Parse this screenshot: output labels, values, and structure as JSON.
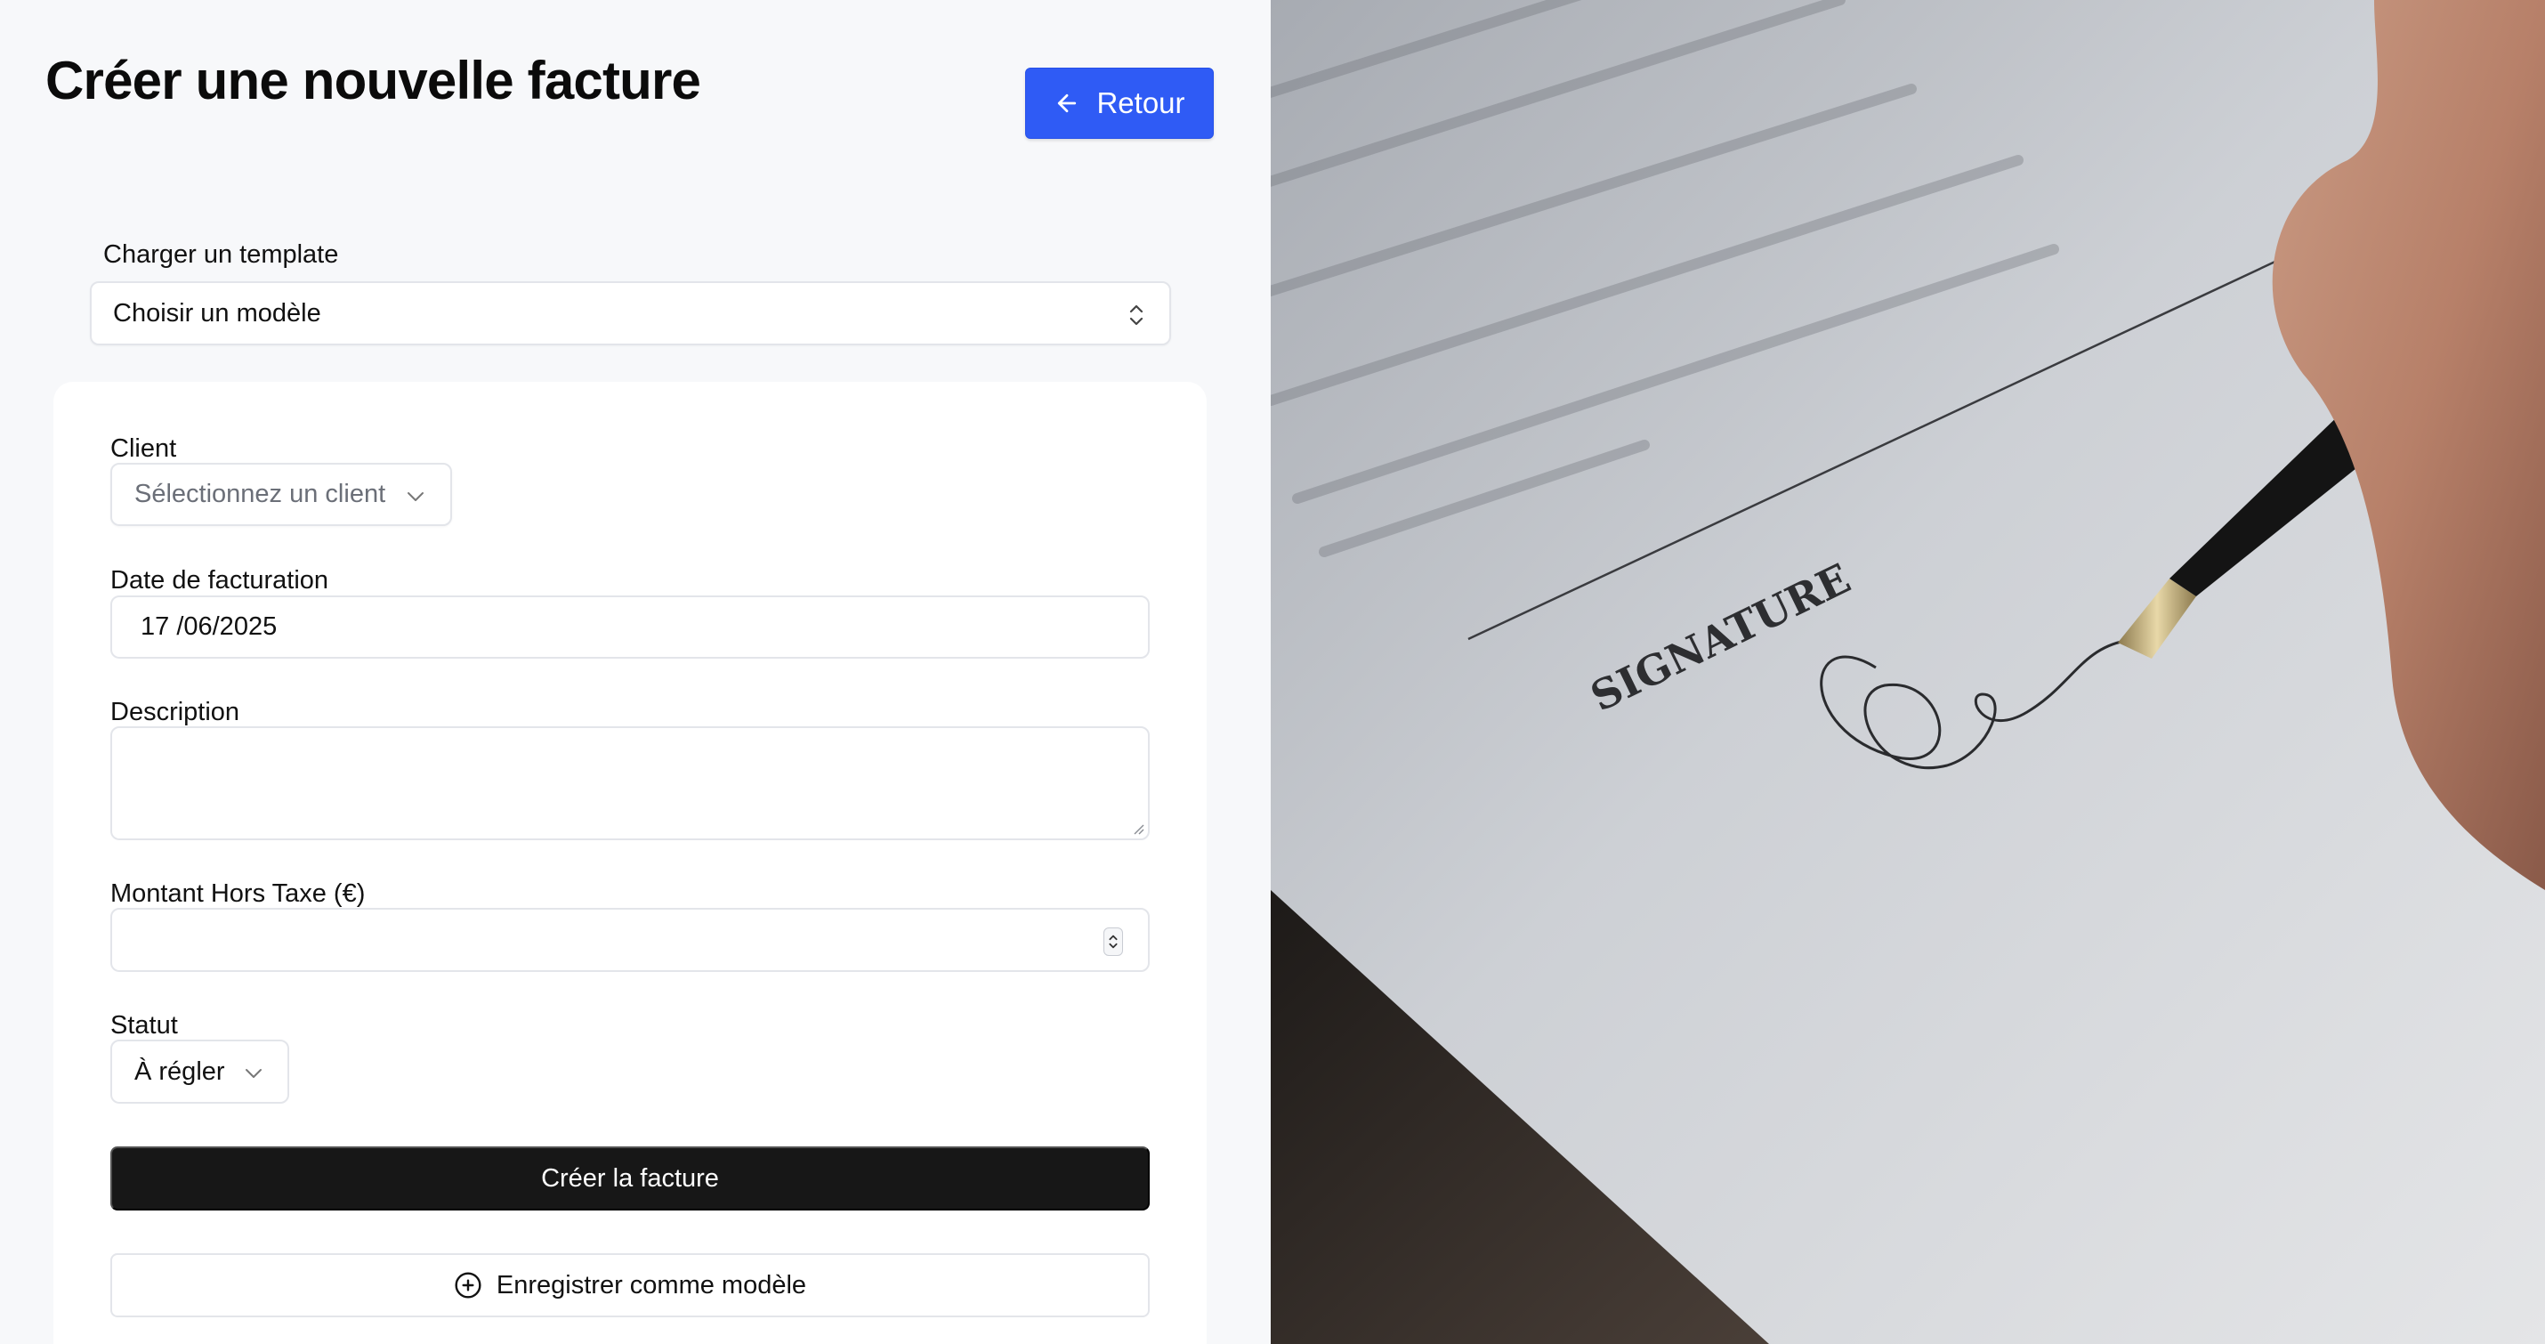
{
  "page": {
    "title": "Créer une nouvelle facture",
    "back_button": {
      "label": "Retour",
      "icon": "arrow-left-icon"
    }
  },
  "template": {
    "label": "Charger un template",
    "selected": "Choisir un modèle"
  },
  "form": {
    "client": {
      "label": "Client",
      "placeholder": "Sélectionnez un client"
    },
    "date": {
      "label": "Date de facturation",
      "value": "17 /06/2025"
    },
    "description": {
      "label": "Description",
      "value": ""
    },
    "amount": {
      "label": "Montant Hors Taxe (€)",
      "value": ""
    },
    "status": {
      "label": "Statut",
      "selected": "À régler"
    },
    "submit_label": "Créer la facture",
    "save_template": {
      "label": "Enregistrer comme modèle",
      "icon": "plus-circle-icon"
    }
  },
  "photo": {
    "signature_word": "SIGNATURE"
  },
  "colors": {
    "accent": "#2f5bf5",
    "primary_button": "#171717",
    "background": "#f7f8fa"
  }
}
